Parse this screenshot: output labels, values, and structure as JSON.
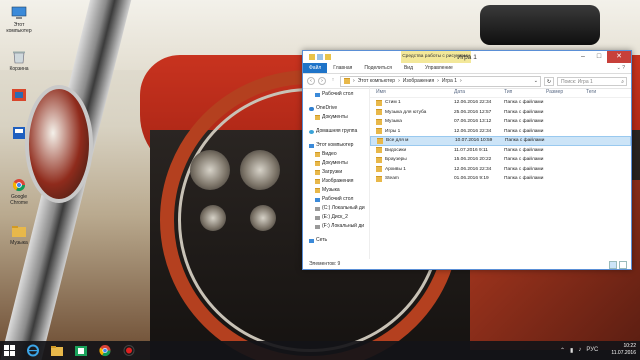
{
  "desktop": {
    "icons": [
      {
        "label": "Этот\nкомпьютер",
        "name": "this-pc-icon"
      },
      {
        "label": "Корзина",
        "name": "recycle-bin-icon"
      },
      {
        "label": "",
        "name": "app-icon-1"
      },
      {
        "label": "",
        "name": "app-icon-2"
      },
      {
        "label": "Google\nChrome",
        "name": "chrome-icon"
      },
      {
        "label": "Музыка",
        "name": "music-folder-icon"
      }
    ]
  },
  "window": {
    "title": "Игра 1",
    "tools_tab": "Средства работы с рисунками",
    "ribbon_tabs": [
      "Файл",
      "Главная",
      "Поделиться",
      "Вид",
      "Управление"
    ],
    "address_path": [
      "Этот компьютер",
      "Изображения",
      "Игра 1"
    ],
    "search_placeholder": "Поиск: Игра 1",
    "nav": [
      {
        "label": "Рабочий стол",
        "indent": 1
      },
      {
        "label": "OneDrive",
        "indent": 0
      },
      {
        "label": "Документы",
        "indent": 1
      },
      {
        "label": "Домашняя группа",
        "indent": 0
      },
      {
        "label": "Этот компьютер",
        "indent": 0
      },
      {
        "label": "Видео",
        "indent": 1
      },
      {
        "label": "Документы",
        "indent": 1
      },
      {
        "label": "Загрузки",
        "indent": 1
      },
      {
        "label": "Изображения",
        "indent": 1
      },
      {
        "label": "Музыка",
        "indent": 1
      },
      {
        "label": "Рабочий стол",
        "indent": 1
      },
      {
        "label": "(C:) Локальный ди",
        "indent": 1
      },
      {
        "label": "(E:) Диск_2",
        "indent": 1
      },
      {
        "label": "(F:) Локальный ди",
        "indent": 1
      },
      {
        "label": "Сеть",
        "indent": 0
      }
    ],
    "columns": [
      "Имя",
      "Дата",
      "Тип",
      "Размер",
      "Теги"
    ],
    "files": [
      {
        "name": "Стим 1",
        "date": "12.06.2016 22:34",
        "type": "Папка с файлами"
      },
      {
        "name": "Музыка для ютуба",
        "date": "25.06.2016 12:57",
        "type": "Папка с файлами"
      },
      {
        "name": "Музыка",
        "date": "07.06.2016 13:12",
        "type": "Папка с файлами"
      },
      {
        "name": "Игры 1",
        "date": "12.06.2016 22:34",
        "type": "Папка с файлами"
      },
      {
        "name": "Все для м",
        "date": "10.07.2016 10:59",
        "type": "Папка с файлами"
      },
      {
        "name": "Видосики",
        "date": "11.07.2016 9:11",
        "type": "Папка с файлами"
      },
      {
        "name": "Браузеры",
        "date": "15.06.2016 20:22",
        "type": "Папка с файлами"
      },
      {
        "name": "Архивы 1",
        "date": "12.06.2016 22:34",
        "type": "Папка с файлами"
      },
      {
        "name": "Steam",
        "date": "01.06.2016 9:19",
        "type": "Папка с файлами"
      }
    ],
    "selected_index": 4,
    "status": "Элементов: 9"
  },
  "taskbar": {
    "lang": "РУС",
    "time": "10:22",
    "date": "11.07.2016"
  }
}
